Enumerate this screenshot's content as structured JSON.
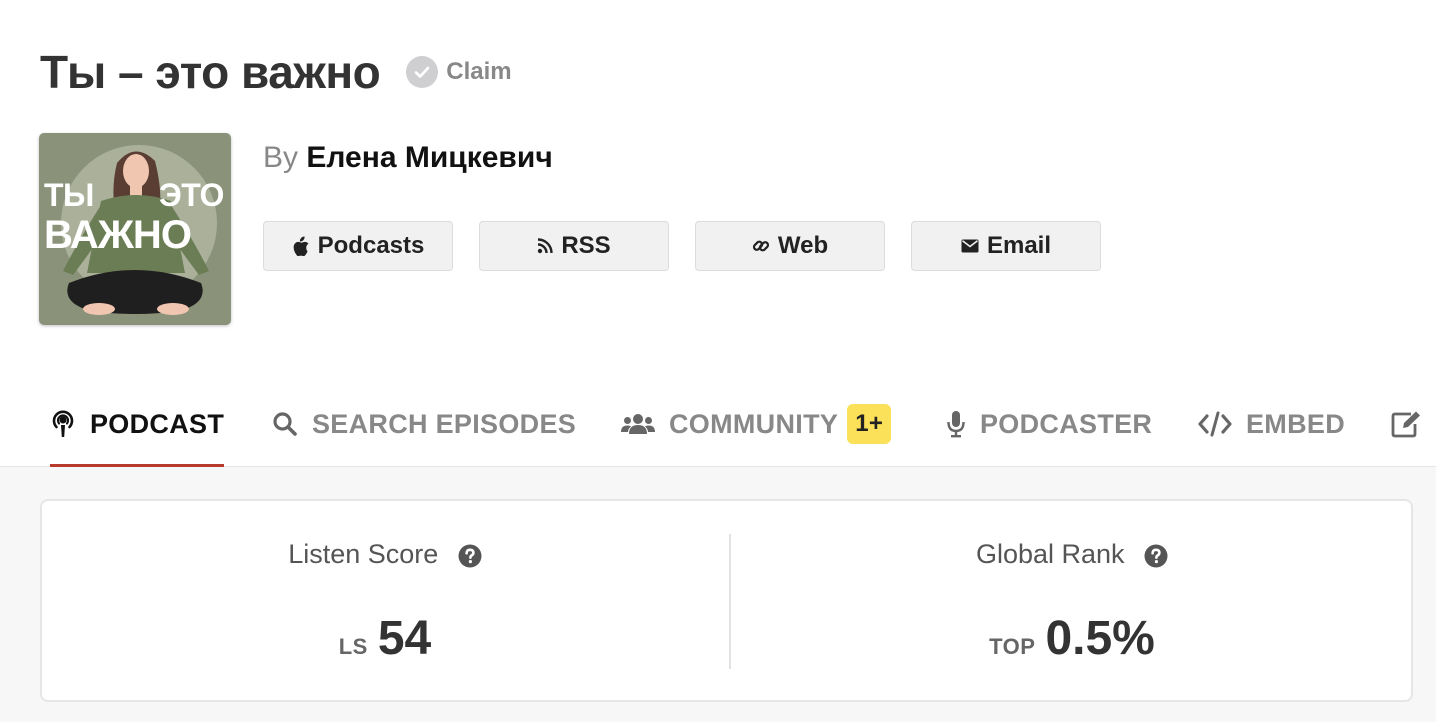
{
  "header": {
    "title": "Ты – это важно",
    "claim_label": "Claim"
  },
  "artwork": {
    "line1_left": "ТЫ",
    "line1_right": "ЭТО",
    "line2": "ВАЖНО"
  },
  "byline": {
    "prefix": "By",
    "author": "Елена Мицкевич"
  },
  "links": {
    "podcasts": "Podcasts",
    "rss": "RSS",
    "web": "Web",
    "email": "Email"
  },
  "tabs": {
    "podcast": "PODCAST",
    "search": "SEARCH EPISODES",
    "community": "COMMUNITY",
    "community_badge": "1+",
    "podcaster": "PODCASTER",
    "embed": "EMBED"
  },
  "stats": {
    "listen_score": {
      "label": "Listen Score",
      "prefix": "LS",
      "value": "54"
    },
    "global_rank": {
      "label": "Global Rank",
      "prefix": "TOP",
      "value": "0.5%"
    }
  },
  "colors": {
    "active_tab_underline": "#b83a2a",
    "badge": "#fbe05a"
  }
}
